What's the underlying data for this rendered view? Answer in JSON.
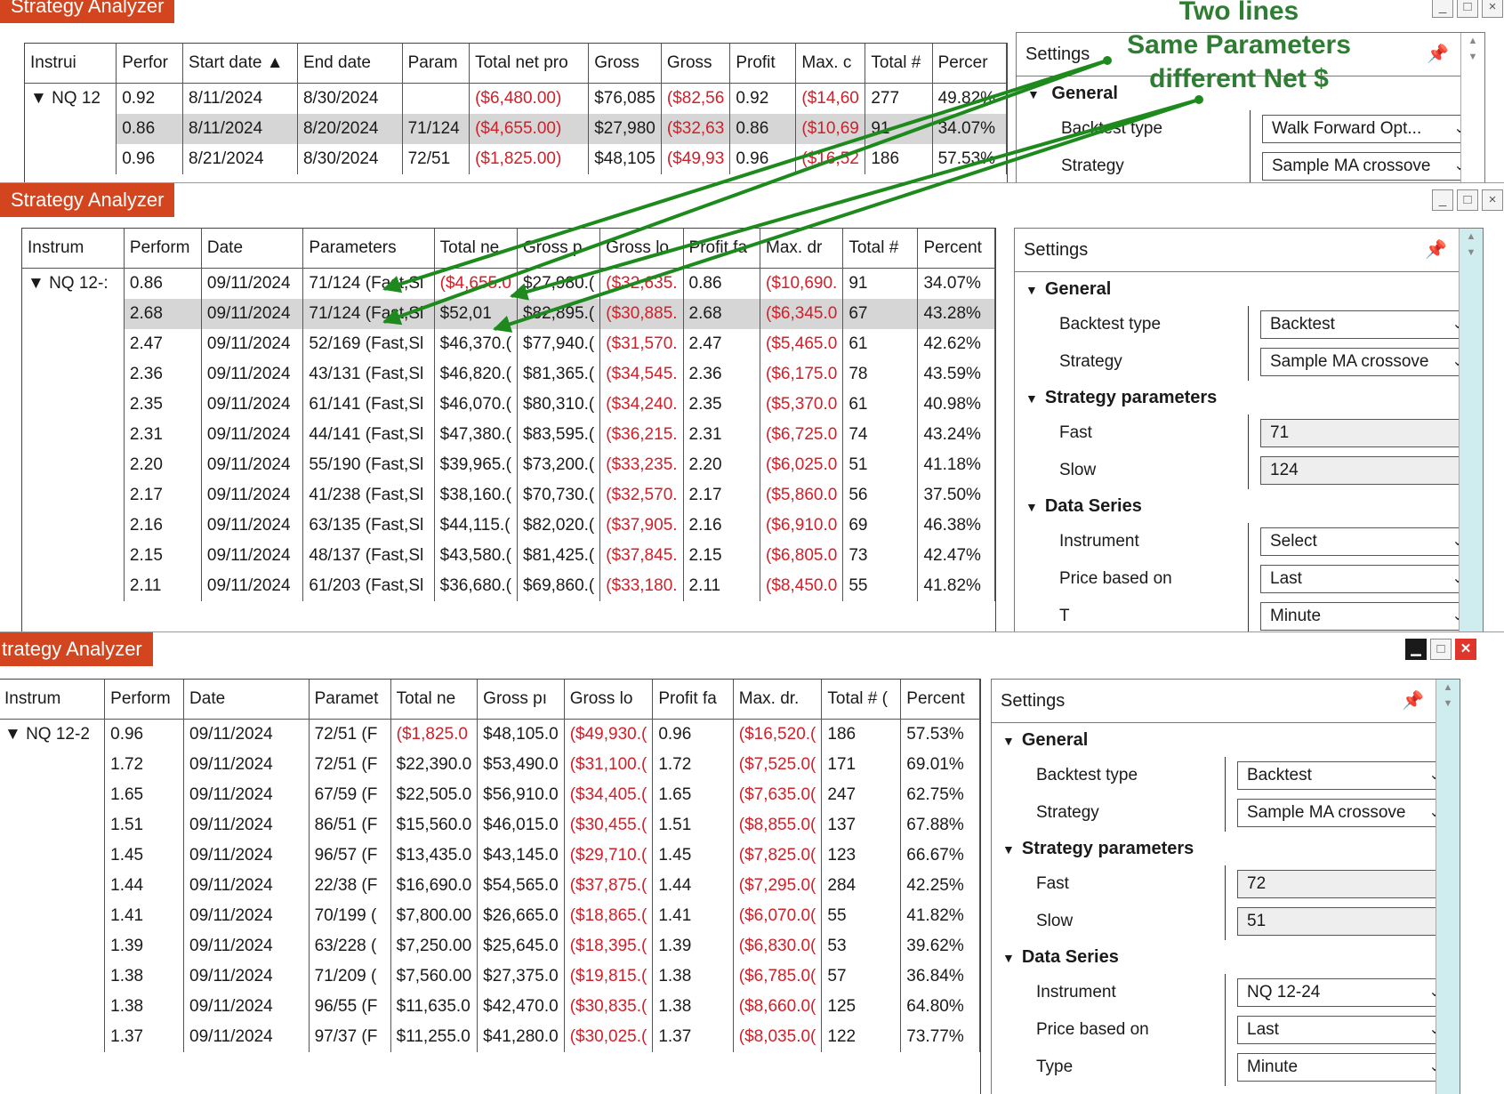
{
  "window1": {
    "title": "Strategy Analyzer",
    "columns": [
      "Instrui",
      "Perfor",
      "Start date ▲",
      "End date",
      "Param",
      "Total net pro",
      "Gross",
      "Gross",
      "Profit",
      "Max. c",
      "Total #",
      "Percer"
    ],
    "rows": [
      [
        "▼ NQ 12",
        "0.92",
        "8/11/2024",
        "8/30/2024",
        "",
        "($6,480.00)",
        "$76,085",
        "($82,56",
        "0.92",
        "($14,60",
        "277",
        "49.82%"
      ],
      [
        "",
        "0.86",
        "8/11/2024",
        "8/20/2024",
        "71/124",
        "($4,655.00)",
        "$27,980",
        "($32,63",
        "0.86",
        "($10,69",
        "91",
        "34.07%"
      ],
      [
        "",
        "0.96",
        "8/21/2024",
        "8/30/2024",
        "72/51",
        "($1,825.00)",
        "$48,105",
        "($49,93",
        "0.96",
        "($16,52",
        "186",
        "57.53%"
      ]
    ],
    "settings": {
      "header": "Settings",
      "pin": "📌",
      "general": "General",
      "rows": [
        {
          "label": "Backtest type",
          "value": "Walk Forward Opt..."
        },
        {
          "label": "Strategy",
          "value": "Sample MA crossove"
        }
      ]
    }
  },
  "window2": {
    "title": "Strategy Analyzer",
    "columns": [
      "Instrum",
      "Perform",
      "Date",
      "Parameters",
      "Total ne",
      "Gross p",
      "Gross lo",
      "Profit fa",
      "Max. dr",
      "Total #",
      "Percent"
    ],
    "rows": [
      [
        "▼ NQ 12-:",
        "0.86",
        "09/11/2024",
        "71/124 (Fast,Sl",
        "($4,655.0",
        "$27,980.(",
        "($32,635.",
        "0.86",
        "($10,690.",
        "91",
        "34.07%"
      ],
      [
        "",
        "2.68",
        "09/11/2024",
        "71/124 (Fast,Sl",
        "$52,01",
        "$82,895.(",
        "($30,885.",
        "2.68",
        "($6,345.0",
        "67",
        "43.28%"
      ],
      [
        "",
        "2.47",
        "09/11/2024",
        "52/169 (Fast,Sl",
        "$46,370.(",
        "$77,940.(",
        "($31,570.",
        "2.47",
        "($5,465.0",
        "61",
        "42.62%"
      ],
      [
        "",
        "2.36",
        "09/11/2024",
        "43/131 (Fast,Sl",
        "$46,820.(",
        "$81,365.(",
        "($34,545.",
        "2.36",
        "($6,175.0",
        "78",
        "43.59%"
      ],
      [
        "",
        "2.35",
        "09/11/2024",
        "61/141 (Fast,Sl",
        "$46,070.(",
        "$80,310.(",
        "($34,240.",
        "2.35",
        "($5,370.0",
        "61",
        "40.98%"
      ],
      [
        "",
        "2.31",
        "09/11/2024",
        "44/141 (Fast,Sl",
        "$47,380.(",
        "$83,595.(",
        "($36,215.",
        "2.31",
        "($6,725.0",
        "74",
        "43.24%"
      ],
      [
        "",
        "2.20",
        "09/11/2024",
        "55/190 (Fast,Sl",
        "$39,965.(",
        "$73,200.(",
        "($33,235.",
        "2.20",
        "($6,025.0",
        "51",
        "41.18%"
      ],
      [
        "",
        "2.17",
        "09/11/2024",
        "41/238 (Fast,Sl",
        "$38,160.(",
        "$70,730.(",
        "($32,570.",
        "2.17",
        "($5,860.0",
        "56",
        "37.50%"
      ],
      [
        "",
        "2.16",
        "09/11/2024",
        "63/135 (Fast,Sl",
        "$44,115.(",
        "$82,020.(",
        "($37,905.",
        "2.16",
        "($6,910.0",
        "69",
        "46.38%"
      ],
      [
        "",
        "2.15",
        "09/11/2024",
        "48/137 (Fast,Sl",
        "$43,580.(",
        "$81,425.(",
        "($37,845.",
        "2.15",
        "($6,805.0",
        "73",
        "42.47%"
      ],
      [
        "",
        "2.11",
        "09/11/2024",
        "61/203 (Fast,Sl",
        "$36,680.(",
        "$69,860.(",
        "($33,180.",
        "2.11",
        "($8,450.0",
        "55",
        "41.82%"
      ]
    ],
    "settings": {
      "header": "Settings",
      "pin": "📌",
      "sections": [
        {
          "name": "General",
          "rows": [
            {
              "label": "Backtest type",
              "value": "Backtest",
              "kind": "select"
            },
            {
              "label": "Strategy",
              "value": "Sample MA crossove",
              "kind": "select"
            }
          ]
        },
        {
          "name": "Strategy parameters",
          "rows": [
            {
              "label": "Fast",
              "value": "71",
              "kind": "input"
            },
            {
              "label": "Slow",
              "value": "124",
              "kind": "input"
            }
          ]
        },
        {
          "name": "Data Series",
          "rows": [
            {
              "label": "Instrument",
              "value": "Select",
              "kind": "select"
            },
            {
              "label": "Price based on",
              "value": "Last",
              "kind": "select"
            },
            {
              "label": "T",
              "value": "Minute",
              "kind": "select"
            }
          ]
        }
      ]
    }
  },
  "window3": {
    "title": "trategy Analyzer",
    "columns": [
      "Instrum",
      "Perform",
      "Date",
      "Paramet",
      "Total ne",
      "Gross pı",
      "Gross lo",
      "Profit fa",
      "Max. dr.",
      "Total # (",
      "Percent"
    ],
    "rows": [
      [
        "▼ NQ 12-2",
        "0.96",
        "09/11/2024",
        "72/51 (F",
        "($1,825.0",
        "$48,105.0",
        "($49,930.(",
        "0.96",
        "($16,520.(",
        "186",
        "57.53%"
      ],
      [
        "",
        "1.72",
        "09/11/2024",
        "72/51 (F",
        "$22,390.0",
        "$53,490.0",
        "($31,100.(",
        "1.72",
        "($7,525.0(",
        "171",
        "69.01%"
      ],
      [
        "",
        "1.65",
        "09/11/2024",
        "67/59 (F",
        "$22,505.0",
        "$56,910.0",
        "($34,405.(",
        "1.65",
        "($7,635.0(",
        "247",
        "62.75%"
      ],
      [
        "",
        "1.51",
        "09/11/2024",
        "86/51 (F",
        "$15,560.0",
        "$46,015.0",
        "($30,455.(",
        "1.51",
        "($8,855.0(",
        "137",
        "67.88%"
      ],
      [
        "",
        "1.45",
        "09/11/2024",
        "96/57 (F",
        "$13,435.0",
        "$43,145.0",
        "($29,710.(",
        "1.45",
        "($7,825.0(",
        "123",
        "66.67%"
      ],
      [
        "",
        "1.44",
        "09/11/2024",
        "22/38 (F",
        "$16,690.0",
        "$54,565.0",
        "($37,875.(",
        "1.44",
        "($7,295.0(",
        "284",
        "42.25%"
      ],
      [
        "",
        "1.41",
        "09/11/2024",
        "70/199 (",
        "$7,800.00",
        "$26,665.0",
        "($18,865.(",
        "1.41",
        "($6,070.0(",
        "55",
        "41.82%"
      ],
      [
        "",
        "1.39",
        "09/11/2024",
        "63/228 (",
        "$7,250.00",
        "$25,645.0",
        "($18,395.(",
        "1.39",
        "($6,830.0(",
        "53",
        "39.62%"
      ],
      [
        "",
        "1.38",
        "09/11/2024",
        "71/209 (",
        "$7,560.00",
        "$27,375.0",
        "($19,815.(",
        "1.38",
        "($6,785.0(",
        "57",
        "36.84%"
      ],
      [
        "",
        "1.38",
        "09/11/2024",
        "96/55 (F",
        "$11,635.0",
        "$42,470.0",
        "($30,835.(",
        "1.38",
        "($8,660.0(",
        "125",
        "64.80%"
      ],
      [
        "",
        "1.37",
        "09/11/2024",
        "97/37 (F",
        "$11,255.0",
        "$41,280.0",
        "($30,025.(",
        "1.37",
        "($8,035.0(",
        "122",
        "73.77%"
      ]
    ],
    "settings": {
      "header": "Settings",
      "pin": "📌",
      "sections": [
        {
          "name": "General",
          "rows": [
            {
              "label": "Backtest type",
              "value": "Backtest",
              "kind": "select"
            },
            {
              "label": "Strategy",
              "value": "Sample MA crossove",
              "kind": "select"
            }
          ]
        },
        {
          "name": "Strategy parameters",
          "rows": [
            {
              "label": "Fast",
              "value": "72",
              "kind": "input"
            },
            {
              "label": "Slow",
              "value": "51",
              "kind": "input"
            }
          ]
        },
        {
          "name": "Data Series",
          "rows": [
            {
              "label": "Instrument",
              "value": "NQ 12-24",
              "kind": "select"
            },
            {
              "label": "Price based on",
              "value": "Last",
              "kind": "select"
            },
            {
              "label": "Type",
              "value": "Minute",
              "kind": "select"
            }
          ]
        }
      ]
    }
  },
  "annotation": {
    "line1": "Two lines",
    "line2": "Same Parameters",
    "line3": "different Net $",
    "color": "#1e8a1e"
  },
  "colors": {
    "title_tab": "#d2451e",
    "negative": "#d0202a",
    "selected_row": "#d6d6d6",
    "scrollbar": "#cfecef"
  }
}
